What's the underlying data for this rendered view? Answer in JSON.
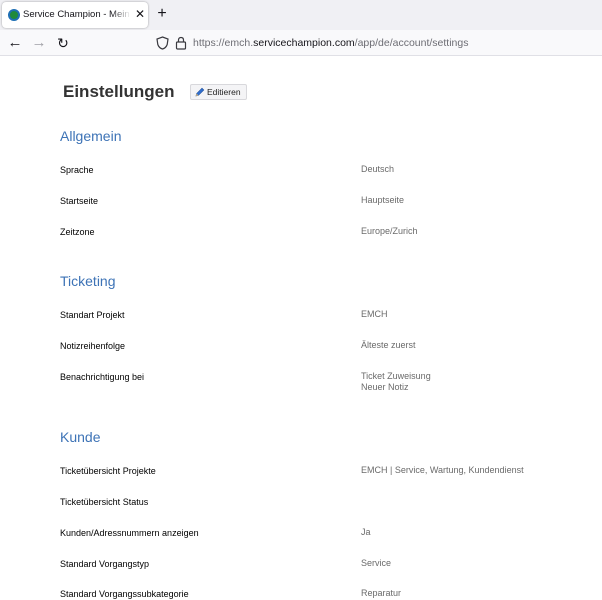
{
  "browser": {
    "tab_title": "Service Champion - Mein Konto",
    "url_prefix": "https://emch.",
    "url_host": "servicechampion.com",
    "url_path": "/app/de/account/settings"
  },
  "page": {
    "title": "Einstellungen",
    "edit_label": "Editieren"
  },
  "sections": [
    {
      "title": "Allgemein",
      "rows": [
        {
          "label": "Sprache",
          "value": "Deutsch"
        },
        {
          "label": "Startseite",
          "value": "Hauptseite"
        },
        {
          "label": "Zeitzone",
          "value": "Europe/Zurich"
        }
      ]
    },
    {
      "title": "Ticketing",
      "rows": [
        {
          "label": "Standart Projekt",
          "value": "EMCH"
        },
        {
          "label": "Notizreihenfolge",
          "value": "Älteste zuerst"
        },
        {
          "label": "Benachrichtigung bei",
          "value_lines": [
            "Ticket Zuweisung",
            "Neuer Notiz"
          ]
        }
      ]
    },
    {
      "title": "Kunde",
      "rows": [
        {
          "label": "Ticketübersicht Projekte",
          "value": "EMCH | Service, Wartung, Kundendienst"
        },
        {
          "label": "Ticketübersicht Status",
          "value": ""
        },
        {
          "label": "Kunden/Adressnummern anzeigen",
          "value": "Ja"
        },
        {
          "label": "Standard Vorgangstyp",
          "value": "Service"
        },
        {
          "label": "Standard Vorgangssubkategorie",
          "value": "Reparatur"
        }
      ]
    }
  ],
  "colors": {
    "section_title": "#3d73b6",
    "value_text": "#6a6a6a"
  }
}
